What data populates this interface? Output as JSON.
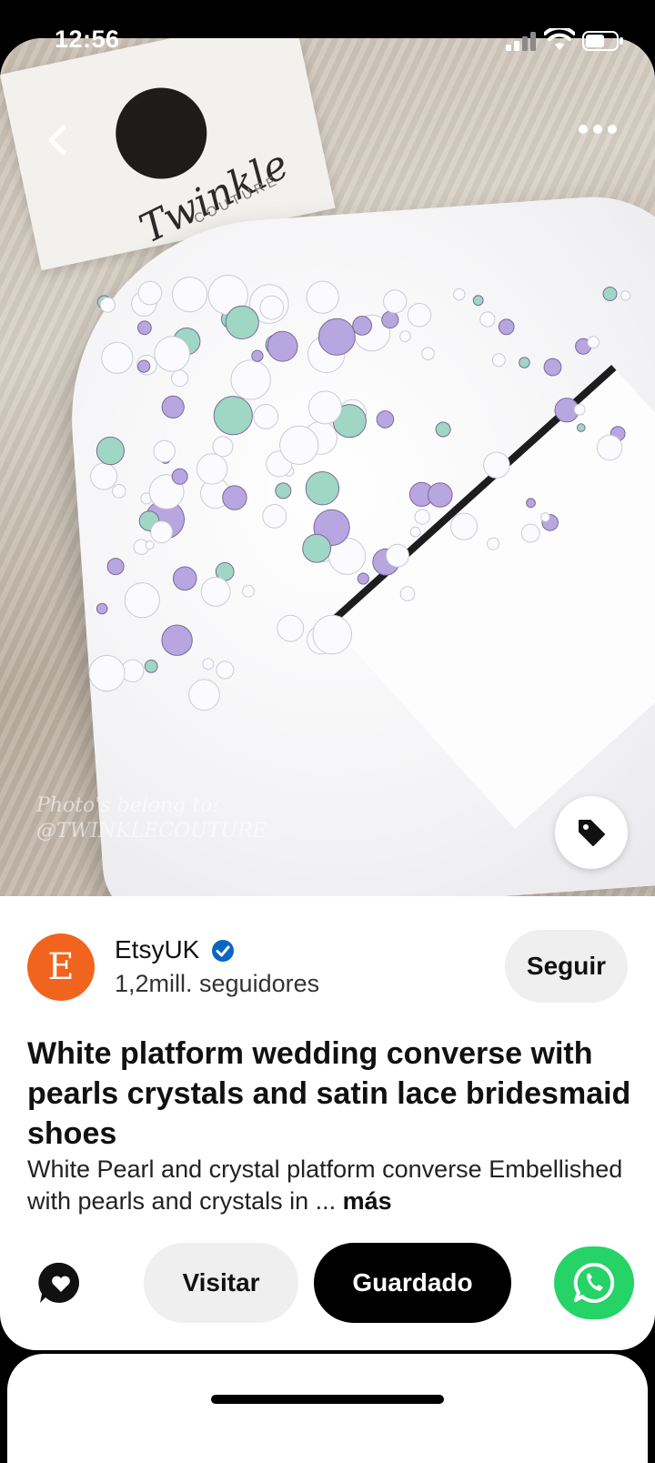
{
  "status_bar": {
    "time": "12:56"
  },
  "photo": {
    "brand_tag_text": "Twinkle",
    "brand_tag_sub": "COUTURE",
    "watermark_line1": "Photo's belong to:",
    "watermark_line2": "@TWINKLECOUTURE"
  },
  "creator": {
    "avatar_letter": "E",
    "avatar_color": "#f1641e",
    "name": "EtsyUK",
    "followers": "1,2mill. seguidores",
    "follow_label": "Seguir"
  },
  "pin": {
    "title": "White platform wedding converse with pearls crystals and satin lace bridesmaid shoes",
    "description": "White Pearl and crystal platform converse Embellished with pearls and crystals in ...",
    "more_label": "más"
  },
  "actions": {
    "visit_label": "Visitar",
    "saved_label": "Guardado",
    "whatsapp_color": "#25d366"
  },
  "icons": {
    "back": "chevron-left-icon",
    "more": "ellipsis-icon",
    "shop_tag": "tag-icon",
    "verified": "verified-check-icon",
    "comment": "comment-heart-icon",
    "whatsapp": "whatsapp-icon"
  }
}
